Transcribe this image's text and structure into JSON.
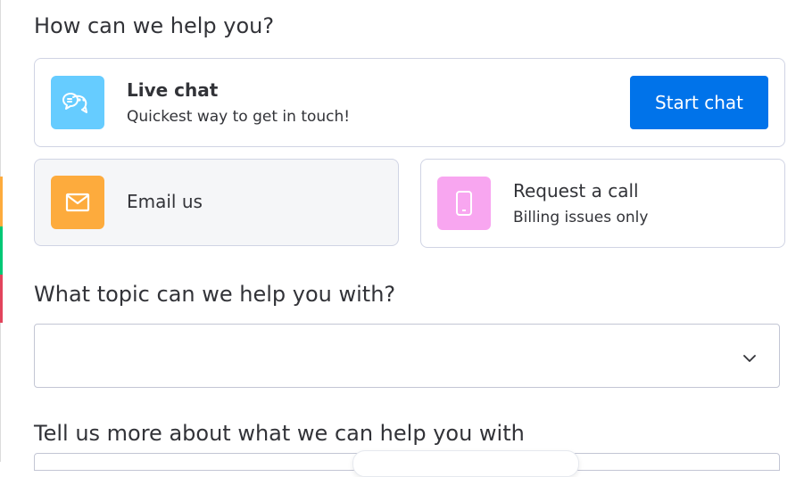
{
  "page": {
    "heading": "How can we help you?",
    "topic_heading": "What topic can we help you with?",
    "details_heading": "Tell us more about what we can help you with"
  },
  "contact_options": {
    "live_chat": {
      "title": "Live chat",
      "subtitle": "Quickest way to get in touch!",
      "button_label": "Start chat",
      "icon": "chat-bubbles-icon",
      "icon_color": "#66ccff"
    },
    "email": {
      "title": "Email us",
      "icon": "envelope-icon",
      "icon_color": "#fdab3d"
    },
    "call": {
      "title": "Request a call",
      "subtitle": "Billing issues only",
      "icon": "phone-icon",
      "icon_color": "#f8a6f0"
    }
  },
  "topic_select": {
    "value": "",
    "icon": "chevron-down-icon"
  },
  "colors": {
    "primary": "#0073ea",
    "text": "#323338",
    "border": "#d0d4e4",
    "selected_bg": "#f5f6f8"
  }
}
